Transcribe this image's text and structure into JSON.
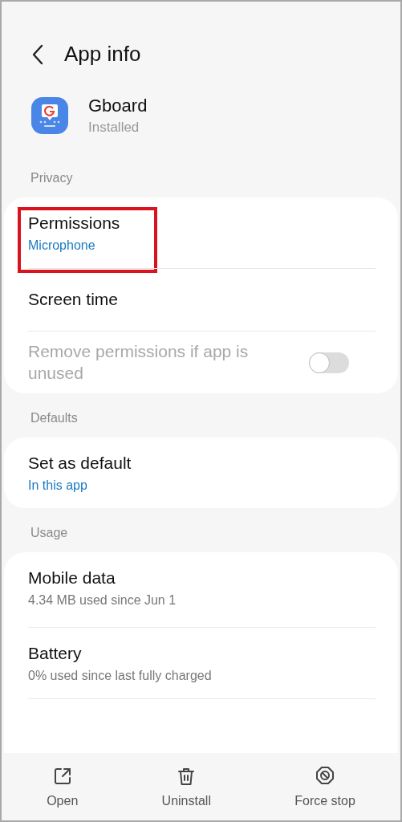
{
  "header": {
    "title": "App info"
  },
  "app": {
    "name": "Gboard",
    "status": "Installed"
  },
  "sections": [
    {
      "label": "Privacy",
      "items": [
        {
          "kind": "link",
          "title": "Permissions",
          "subtitle": "Microphone",
          "accent": true,
          "highlighted": true
        },
        {
          "kind": "link",
          "title": "Screen time",
          "highlighted": false
        },
        {
          "kind": "toggle",
          "title": "Remove permissions if app is unused",
          "on": false,
          "disabled": true,
          "highlighted": false
        }
      ]
    },
    {
      "label": "Defaults",
      "items": [
        {
          "kind": "link",
          "title": "Set as default",
          "subtitle": "In this app",
          "accent": true,
          "highlighted": false
        }
      ]
    },
    {
      "label": "Usage",
      "items": [
        {
          "kind": "link",
          "title": "Mobile data",
          "subtitle": "4.34 MB used since Jun 1",
          "accent": false,
          "highlighted": false
        },
        {
          "kind": "link",
          "title": "Battery",
          "subtitle": "0% used since last fully charged",
          "accent": false,
          "highlighted": false
        }
      ]
    }
  ],
  "actions": [
    {
      "kind": "open",
      "label": "Open"
    },
    {
      "kind": "uninstall",
      "label": "Uninstall"
    },
    {
      "kind": "force_stop",
      "label": "Force stop"
    }
  ]
}
